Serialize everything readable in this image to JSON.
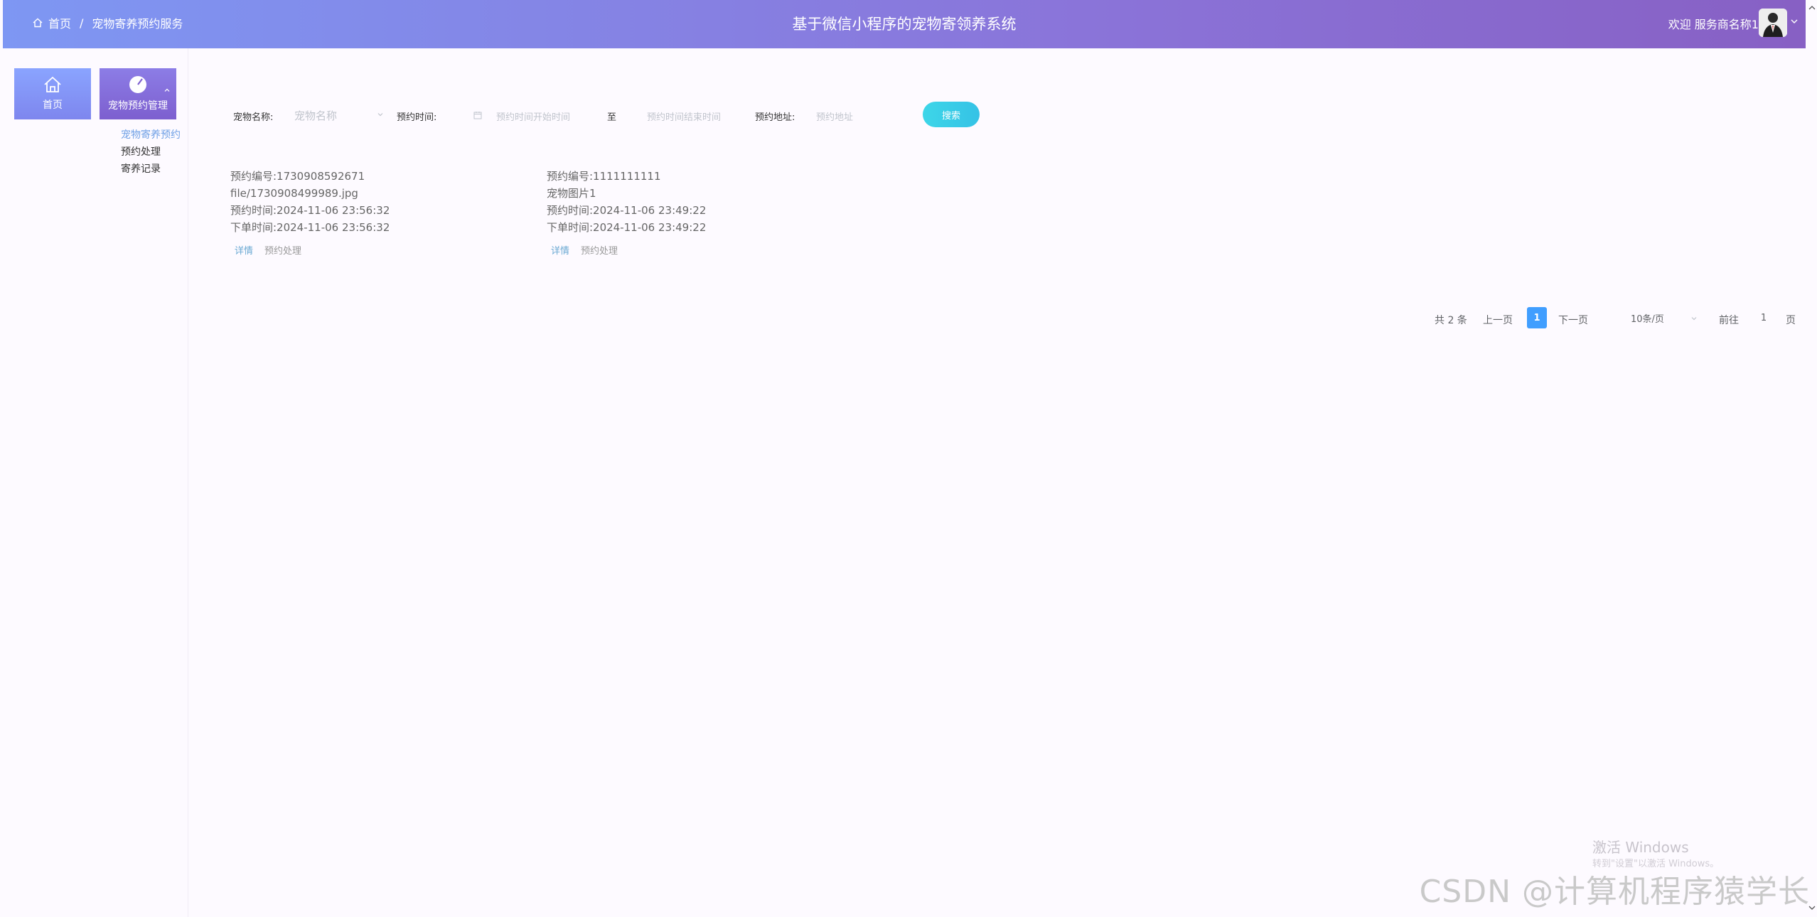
{
  "header": {
    "breadcrumb": {
      "home": "首页",
      "separator": "/",
      "current": "宠物寄养预约服务"
    },
    "title": "基于微信小程序的宠物寄领养系统",
    "welcome": "欢迎 服务商名称1"
  },
  "sidebar": {
    "tiles": [
      {
        "label": "首页",
        "icon": "home-icon"
      },
      {
        "label": "宠物预约管理",
        "icon": "pie-chart-icon"
      }
    ],
    "submenu": [
      {
        "label": "宠物寄养预约",
        "active": true
      },
      {
        "label": "预约处理",
        "active": false
      },
      {
        "label": "寄养记录",
        "active": false
      }
    ],
    "active_color": "#6fa0e6"
  },
  "search": {
    "pet_name_label": "宠物名称:",
    "pet_name_placeholder": "宠物名称",
    "time_label": "预约时间:",
    "start_placeholder": "预约时间开始时间",
    "to": "至",
    "end_placeholder": "预约时间结束时间",
    "address_label": "预约地址:",
    "address_placeholder": "预约地址",
    "search_button": "搜索"
  },
  "records": [
    {
      "no": "预约编号:1730908592671",
      "image": "file/1730908499989.jpg",
      "reserve_time": "预约时间:2024-11-06 23:56:32",
      "order_time": "下单时间:2024-11-06 23:56:32",
      "detail": "详情",
      "process": "预约处理"
    },
    {
      "no": "预约编号:1111111111",
      "image": "宠物图片1",
      "reserve_time": "预约时间:2024-11-06 23:49:22",
      "order_time": "下单时间:2024-11-06 23:49:22",
      "detail": "详情",
      "process": "预约处理"
    }
  ],
  "pagination": {
    "total": "共 2 条",
    "prev": "上一页",
    "current_page": "1",
    "next": "下一页",
    "page_size": "10条/页",
    "goto": "前往",
    "jump_value": "1",
    "page_suffix": "页"
  },
  "watermarks": {
    "activate": "激活 Windows",
    "activate_sub": "转到\"设置\"以激活 Windows。",
    "csdn": "CSDN @计算机程序猿学长"
  },
  "colors": {
    "header_start": "#7e97f3",
    "header_end": "#8760c4",
    "search_button": "#3dd6e8",
    "page_active": "#409eff"
  }
}
